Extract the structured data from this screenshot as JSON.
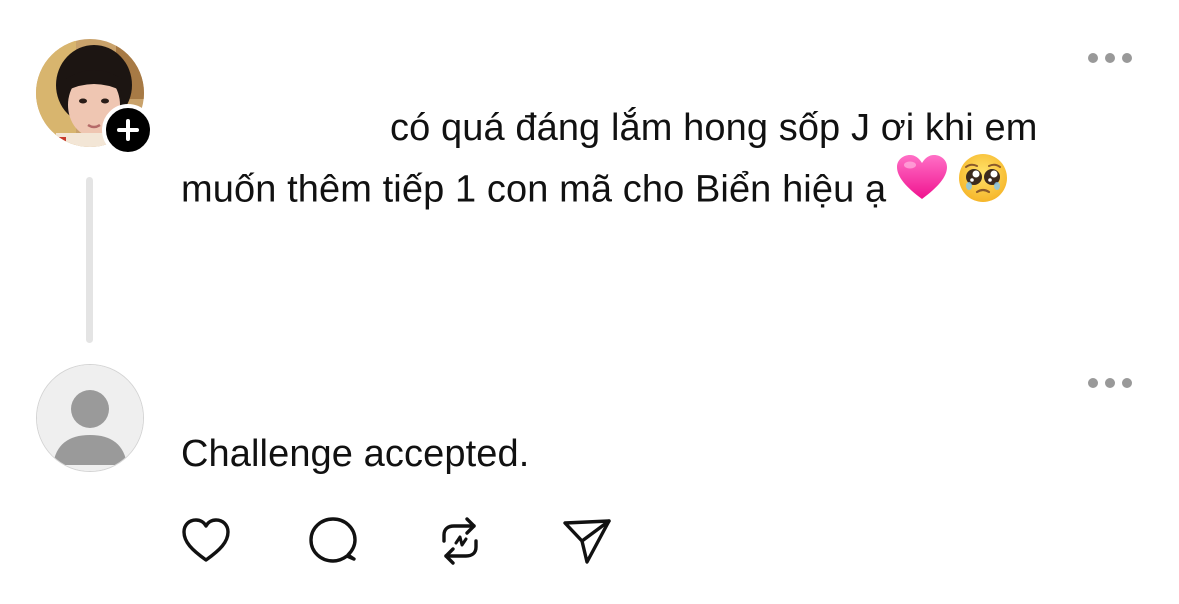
{
  "post": {
    "author_avatar": "user-photo-avatar",
    "follow_icon": "plus-icon",
    "more_icon": "ellipsis-icon",
    "text_line_1": "có quá đáng lắm hong sốp J ơi khi em",
    "text_line_2": "muốn thêm tiếp 1 con mã cho Biển hiệu ạ",
    "emojis": [
      "pink-heart-emoji",
      "pleading-face-emoji"
    ]
  },
  "reply": {
    "author_avatar": "default-user-avatar",
    "more_icon": "ellipsis-icon",
    "text": "Challenge accepted.",
    "actions": [
      "heart-icon",
      "comment-icon",
      "repost-icon",
      "share-icon"
    ]
  },
  "colors": {
    "heart_emoji": "#ff2fa7",
    "thread_line": "#e4e4e4",
    "icon_gray": "#999999",
    "text": "#111111"
  }
}
